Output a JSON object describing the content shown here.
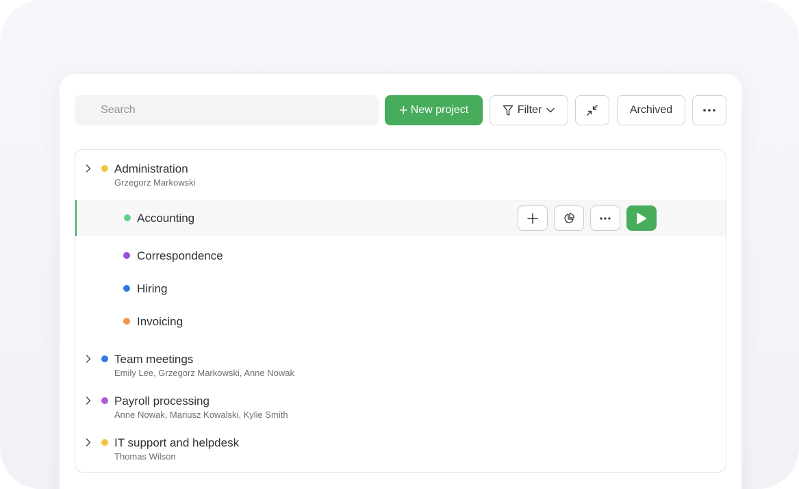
{
  "toolbar": {
    "search_placeholder": "Search",
    "new_project_label": "New project",
    "filter_label": "Filter",
    "archived_label": "Archived"
  },
  "projects": [
    {
      "name": "Administration",
      "members": "Grzegorz Markowski",
      "color": "#f2c53d",
      "children": [
        {
          "name": "Accounting",
          "color": "#5fcf8a"
        },
        {
          "name": "Correspondence",
          "color": "#9b4de0"
        },
        {
          "name": "Hiring",
          "color": "#2f7be5"
        },
        {
          "name": "Invoicing",
          "color": "#f5954a"
        }
      ]
    },
    {
      "name": "Team meetings",
      "members": "Emily Lee, Grzegorz Markowski, Anne Nowak",
      "color": "#2f7be5"
    },
    {
      "name": "Payroll processing",
      "members": "Anne Nowak, Mariusz Kowalski, Kylie Smith",
      "color": "#b15ad8"
    },
    {
      "name": "IT support and helpdesk",
      "members": "Thomas Wilson",
      "color": "#f2c53d"
    }
  ],
  "colors": {
    "accent": "#47ad5c"
  }
}
